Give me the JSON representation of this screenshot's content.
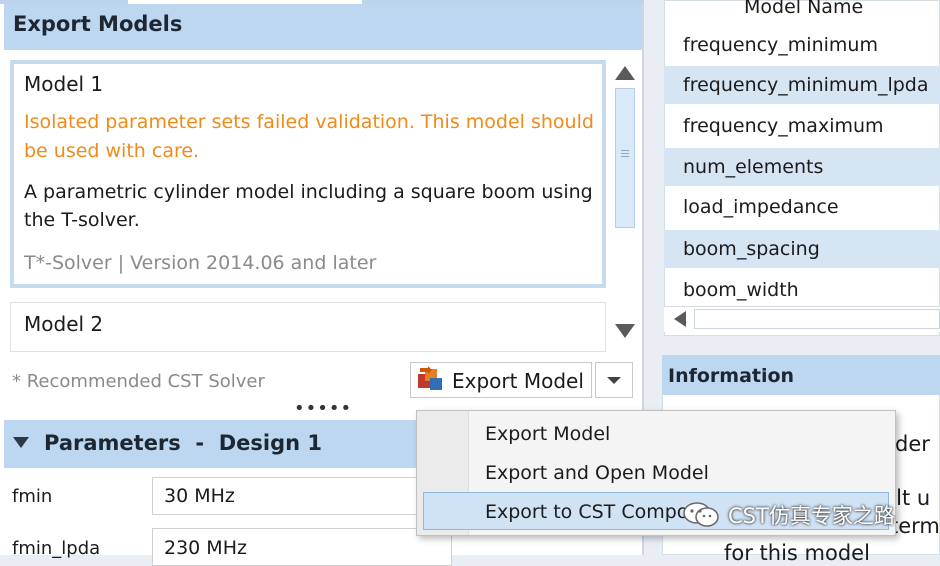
{
  "export_panel": {
    "title": "Export Models",
    "models": [
      {
        "name": "Model 1",
        "warning": "Isolated parameter sets failed validation. This model should be used with care.",
        "description": "A parametric cylinder model including a square boom using the T-solver.",
        "solver": "T*-Solver | Version 2014.06 and later"
      },
      {
        "name": "Model 2"
      }
    ],
    "recommended_note": "* Recommended CST Solver",
    "export_button_label": "Export Model",
    "splitter_glyph": "•••••"
  },
  "parameters": {
    "title": "Parameters  -  Design 1",
    "rows": [
      {
        "label": "fmin",
        "value": "30 MHz"
      },
      {
        "label": "fmin_lpda",
        "value": "230 MHz"
      }
    ]
  },
  "model_names": {
    "header": "Model Name",
    "rows": [
      "frequency_minimum",
      "frequency_minimum_lpda",
      "frequency_maximum",
      "num_elements",
      "load_impedance",
      "boom_spacing",
      "boom_width"
    ]
  },
  "information": {
    "title": "Information",
    "visible_fragments": [
      "der",
      "uilt u",
      "term",
      "for this model"
    ]
  },
  "export_menu": {
    "items": [
      "Export Model",
      "Export and Open Model",
      "Export to CST Compo"
    ]
  },
  "watermark": {
    "text": "CST仿真专家之路"
  },
  "colors": {
    "header_bg": "#bcd7ef",
    "warning": "#f08a18",
    "row_alt": "#d6e5f3",
    "menu_highlight": "#cfe3f5"
  }
}
